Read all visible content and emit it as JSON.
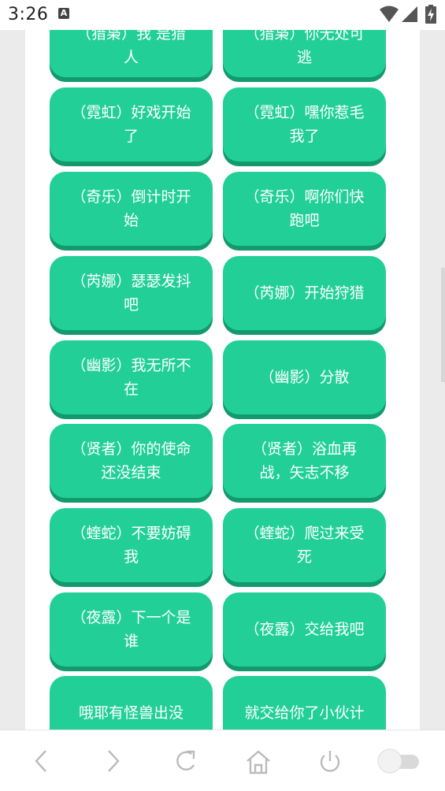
{
  "status_bar": {
    "time": "3:26",
    "notification_icon": "font-a-icon",
    "icons": [
      "wifi-icon",
      "cell-signal-icon",
      "battery-charging-icon"
    ]
  },
  "buttons": [
    {
      "id": "b0",
      "text": "（猎枭）我 是猎人"
    },
    {
      "id": "b1",
      "text": "（猎枭）你无处可逃"
    },
    {
      "id": "b2",
      "text": "（霓虹）好戏开始了"
    },
    {
      "id": "b3",
      "text": "（霓虹）嘿你惹毛我了"
    },
    {
      "id": "b4",
      "text": "（奇乐）倒计时开始"
    },
    {
      "id": "b5",
      "text": "（奇乐）啊你们快跑吧"
    },
    {
      "id": "b6",
      "text": "（芮娜）瑟瑟发抖吧"
    },
    {
      "id": "b7",
      "text": "（芮娜）开始狩猎"
    },
    {
      "id": "b8",
      "text": "（幽影）我无所不在"
    },
    {
      "id": "b9",
      "text": "（幽影）分散"
    },
    {
      "id": "b10",
      "text": "（贤者）你的使命还没结束"
    },
    {
      "id": "b11",
      "text": "（贤者）浴血再战，矢志不移"
    },
    {
      "id": "b12",
      "text": "（蝰蛇）不要妨碍我"
    },
    {
      "id": "b13",
      "text": "（蝰蛇）爬过来受死"
    },
    {
      "id": "b14",
      "text": "（夜露）下一个是谁"
    },
    {
      "id": "b15",
      "text": "（夜露）交给我吧"
    },
    {
      "id": "b16",
      "text": "哦耶有怪兽出没"
    },
    {
      "id": "b17",
      "text": "就交给你了小伙计"
    }
  ],
  "bottom_nav": {
    "items": [
      "back-icon",
      "forward-icon",
      "refresh-icon",
      "home-icon",
      "power-icon",
      "toggle-switch"
    ]
  },
  "colors": {
    "button": "#22d097",
    "button_shadow": "#129a6c",
    "button_text": "#ffffff",
    "nav_icon": "#bbbbbb"
  }
}
